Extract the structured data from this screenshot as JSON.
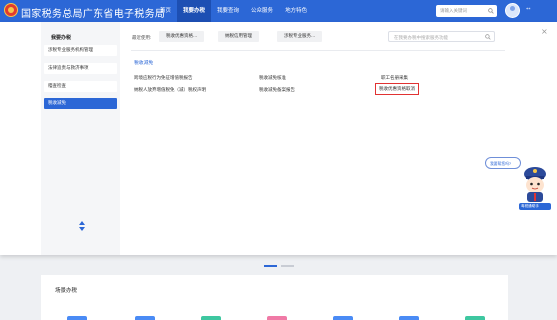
{
  "header": {
    "site_title": "国家税务总局广东省电子税务局",
    "nav": [
      "首页",
      "我要办税",
      "我要查询",
      "公众服务",
      "地方特色"
    ],
    "active_nav": 1,
    "search_placeholder": "请输入关键词",
    "user_name": "**"
  },
  "sidebar": {
    "title": "我要办税",
    "items": [
      "涉税专业服务机构管理",
      "法律追责与救济事项",
      "稽查检查",
      "税收减免"
    ],
    "active_index": 3
  },
  "panel": {
    "recent_label": "最近使用:",
    "recent_items": [
      "税收优惠资格...",
      "纳税信用管理",
      "涉税专业服务..."
    ],
    "search_placeholder": "在我要办税中搜索服务功能",
    "close": "×",
    "section_title": "税收减免",
    "links": [
      "跨境应税行为免征增值税报告",
      "税收减免核准",
      "职工名册采集",
      "纳税人放弃增值税免（减）税权声明",
      "税收减免备案报告",
      "税收优惠资格取消"
    ],
    "highlight_index": 5
  },
  "assistant": {
    "bubble": "我要帮您吗?",
    "caption": "粤税通助手"
  },
  "page": {
    "scene_title": "场景办税"
  },
  "colors": {
    "brand_blue": "#2c67d6",
    "highlight_red": "#e13232",
    "tiles": [
      "#4a8bf5",
      "#4a8bf5",
      "#3ec7a0",
      "#f07aa6",
      "#4a8bf5",
      "#4a8bf5",
      "#3ec7a0"
    ]
  }
}
